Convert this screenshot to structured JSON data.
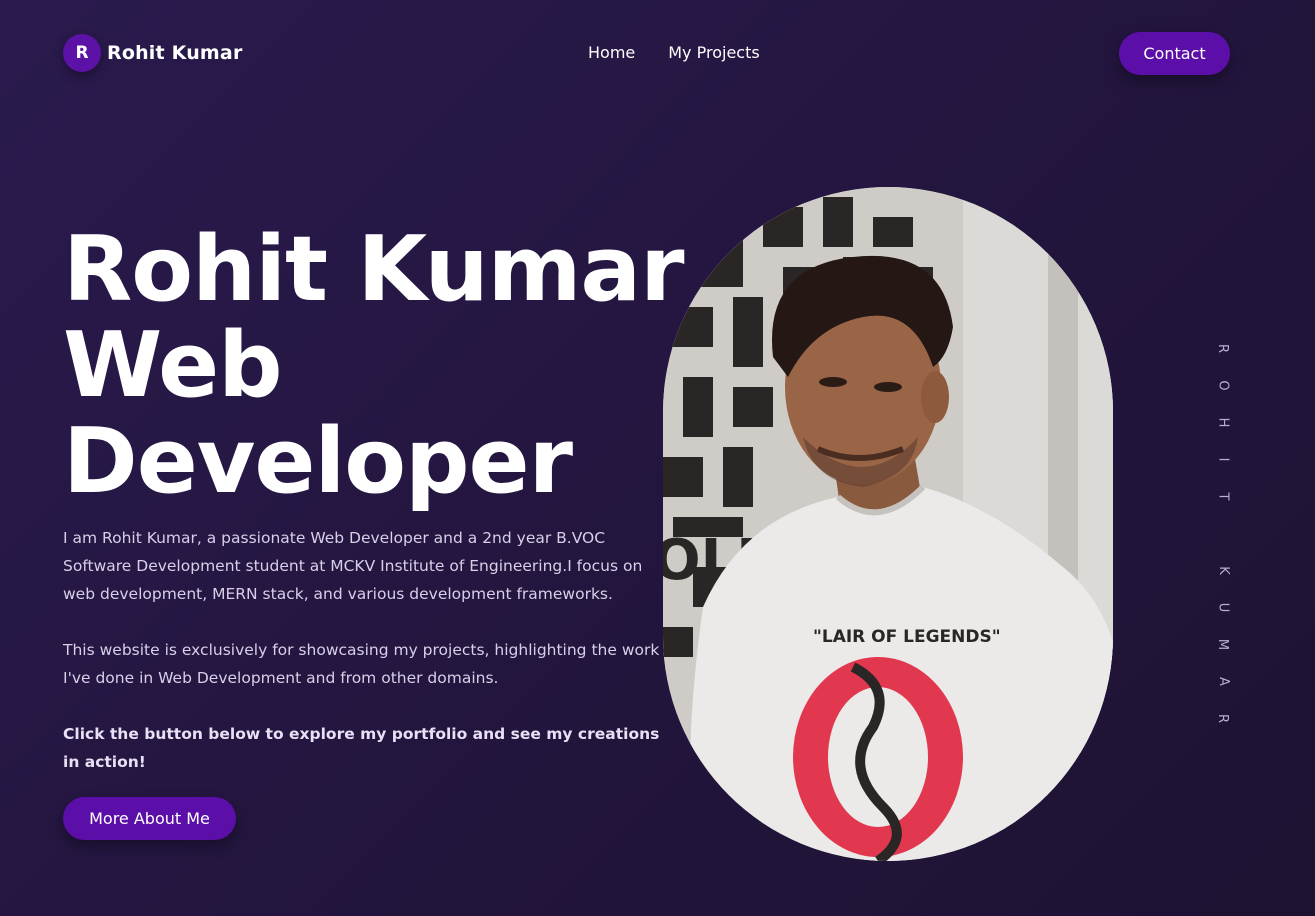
{
  "nav": {
    "brand_initial": "R",
    "brand_name": "Rohit Kumar",
    "links": [
      "Home",
      "My Projects"
    ],
    "contact_label": "Contact"
  },
  "hero": {
    "title_lines": [
      "Rohit Kumar",
      "Web",
      "Developer"
    ],
    "bio_paragraphs": [
      "I am Rohit Kumar, a passionate Web Developer and a 2nd year B.VOC Software Development student at MCKV Institute of Engineering.I focus on web development, MERN stack, and various development frameworks.",
      "This website is exclusively for showcasing my projects, highlighting the work I've done in Web Development and from other domains."
    ],
    "cta_text": "Click the button below to explore my portfolio and see my creations in action!",
    "button_label": "More About Me"
  },
  "portrait": {
    "shirt_text": "\"LAIR OF LEGENDS\"",
    "background_text": "OLLO"
  },
  "side_text": [
    "R",
    "O",
    "H",
    "I",
    "T",
    "",
    "K",
    "U",
    "M",
    "A",
    "R"
  ],
  "colors": {
    "background": "#241640",
    "accent": "#5c0fa8",
    "text": "#ffffff",
    "muted_text": "#d8cfe8"
  }
}
